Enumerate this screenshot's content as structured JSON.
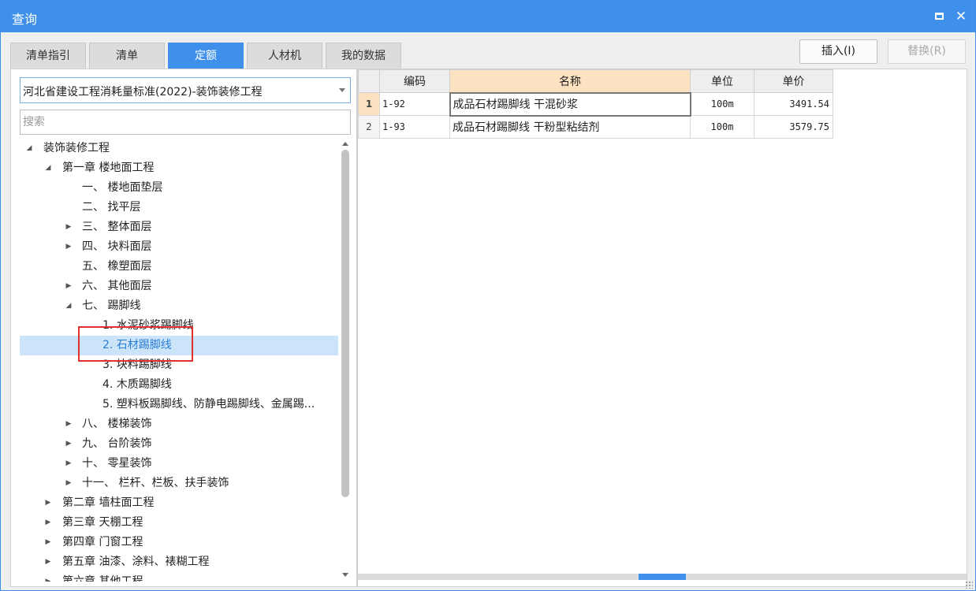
{
  "window": {
    "title": "查询"
  },
  "tabs": [
    {
      "label": "清单指引",
      "active": false
    },
    {
      "label": "清单",
      "active": false
    },
    {
      "label": "定额",
      "active": true
    },
    {
      "label": "人材机",
      "active": false
    },
    {
      "label": "我的数据",
      "active": false
    }
  ],
  "buttons": {
    "insert": "插入(I)",
    "replace": "替换(R)"
  },
  "library": {
    "selected": "河北省建设工程消耗量标准(2022)-装饰装修工程"
  },
  "search": {
    "placeholder": "搜索",
    "value": ""
  },
  "tree": [
    {
      "label": "装饰装修工程",
      "expander": "◢"
    },
    {
      "label": "第一章 楼地面工程",
      "expander": "◢"
    },
    {
      "label": "一、 楼地面垫层",
      "expander": ""
    },
    {
      "label": "二、 找平层",
      "expander": ""
    },
    {
      "label": "三、 整体面层",
      "expander": "▶"
    },
    {
      "label": "四、 块料面层",
      "expander": "▶"
    },
    {
      "label": "五、 橡塑面层",
      "expander": ""
    },
    {
      "label": "六、 其他面层",
      "expander": "▶"
    },
    {
      "label": "七、 踢脚线",
      "expander": "◢"
    },
    {
      "label": "1. 水泥砂浆踢脚线",
      "expander": ""
    },
    {
      "label": "2. 石材踢脚线",
      "expander": "",
      "selected": true
    },
    {
      "label": "3. 块料踢脚线",
      "expander": ""
    },
    {
      "label": "4. 木质踢脚线",
      "expander": ""
    },
    {
      "label": "5. 塑料板踢脚线、防静电踢脚线、金属踢...",
      "expander": ""
    },
    {
      "label": "八、 楼梯装饰",
      "expander": "▶"
    },
    {
      "label": "九、 台阶装饰",
      "expander": "▶"
    },
    {
      "label": "十、 零星装饰",
      "expander": "▶"
    },
    {
      "label": "十一、 栏杆、栏板、扶手装饰",
      "expander": "▶"
    },
    {
      "label": "第二章 墙柱面工程",
      "expander": "▶"
    },
    {
      "label": "第三章 天棚工程",
      "expander": "▶"
    },
    {
      "label": "第四章 门窗工程",
      "expander": "▶"
    },
    {
      "label": "第五章 油漆、涂料、裱糊工程",
      "expander": "▶"
    },
    {
      "label": "第六章 其他工程",
      "expander": "▶"
    }
  ],
  "grid": {
    "columns": [
      "编码",
      "名称",
      "单位",
      "单价"
    ],
    "rows": [
      {
        "num": "1",
        "code": "1-92",
        "name": "成品石材踢脚线 干混砂浆",
        "unit": "100m",
        "price": "3491.54"
      },
      {
        "num": "2",
        "code": "1-93",
        "name": "成品石材踢脚线 干粉型粘结剂",
        "unit": "100m",
        "price": "3579.75"
      }
    ]
  }
}
